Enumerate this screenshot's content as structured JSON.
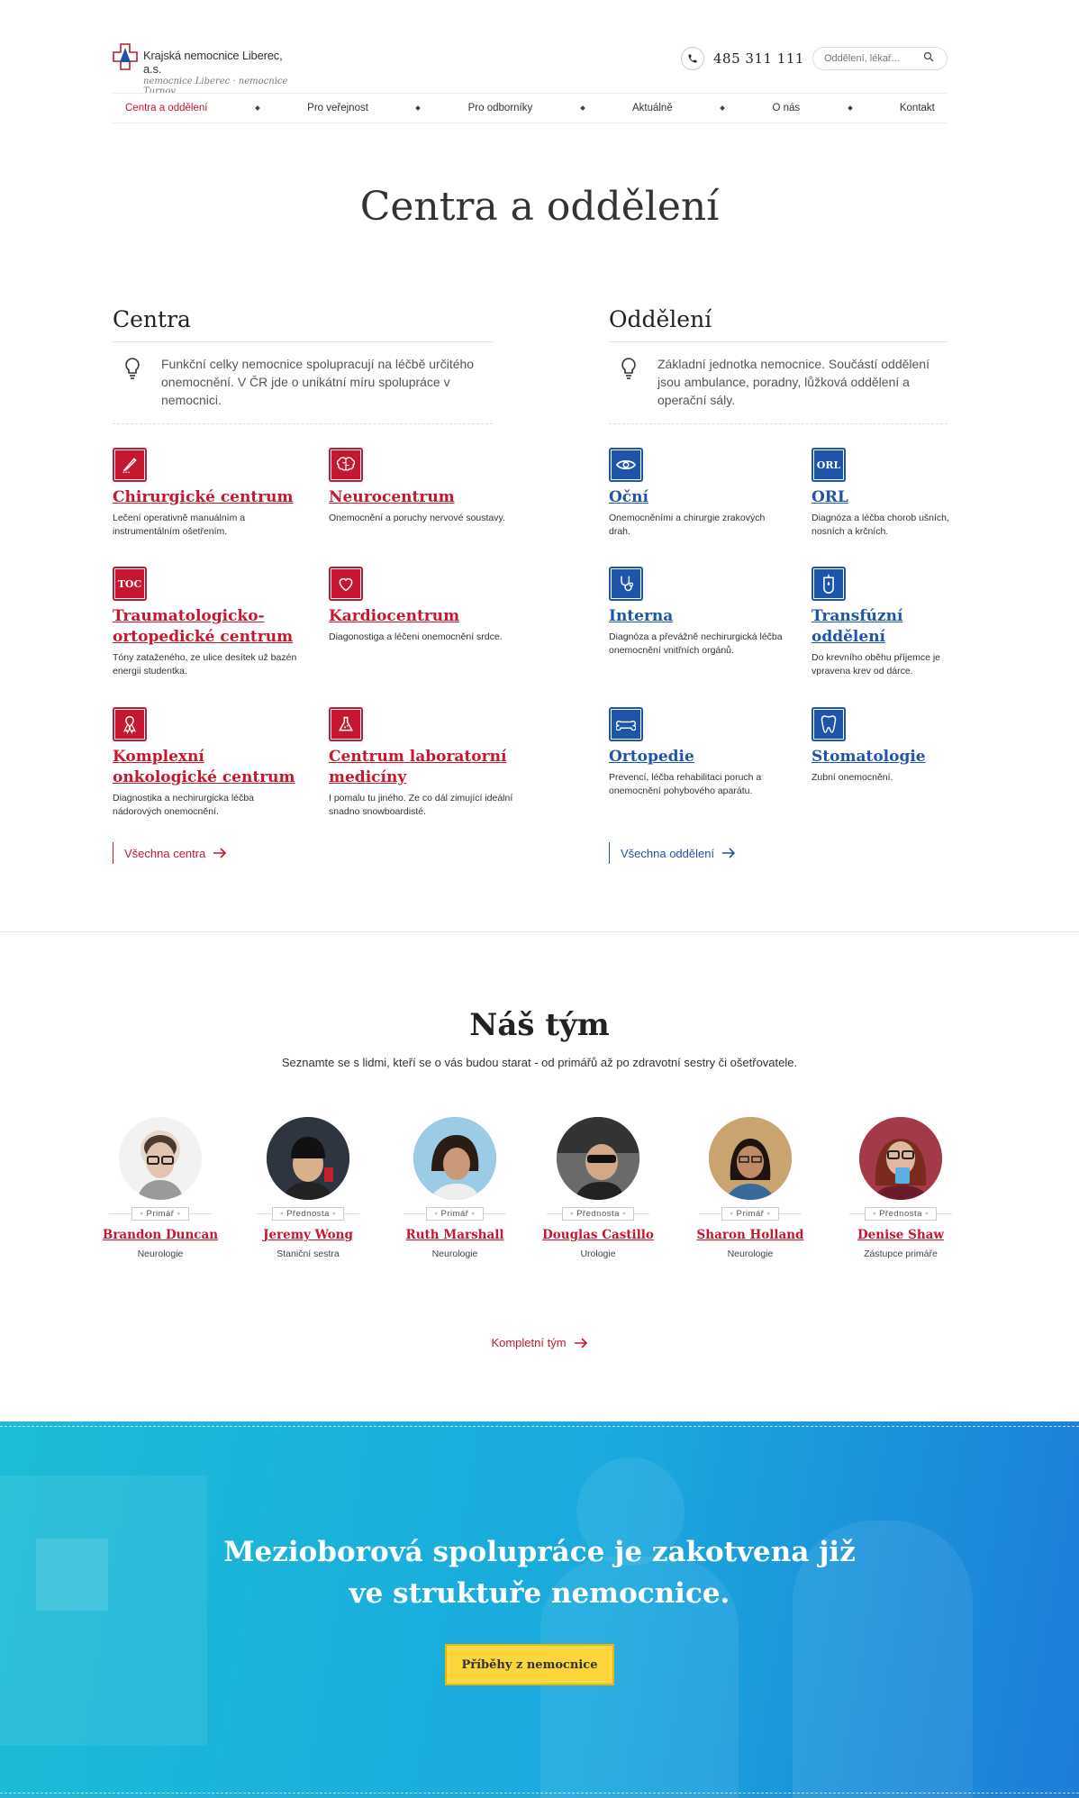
{
  "header": {
    "logo_name": "Krajská nemocnice Liberec, a.s.",
    "logo_sub": "nemocnice Liberec · nemocnice Turnov",
    "phone": "485 311 111",
    "search_placeholder": "Oddělení, lékař..."
  },
  "nav": {
    "items": [
      "Centra a oddělení",
      "Pro veřejnost",
      "Pro odborníky",
      "Aktuálně",
      "O nás",
      "Kontakt"
    ],
    "active": "Centra a oddělení"
  },
  "page_title": "Centra a oddělení",
  "centra": {
    "heading": "Centra",
    "description": "Funkční celky nemocnice spolupracují na léčbě určitého onemocnění. V ČR jde o unikátní míru spolupráce v nemocnici.",
    "items": [
      {
        "title": "Chirurgické centrum",
        "desc": "Lečení operativně manuálním a instrumentálním ošetřením.",
        "icon": "scalpel-icon"
      },
      {
        "title": "Neurocentrum",
        "desc": "Onemocnění a poruchy nervové soustavy.",
        "icon": "brain-icon"
      },
      {
        "title": "Traumatologicko-ortopedické centrum",
        "desc": "Tóny zataženého, ze ulice desítek už bazén energii studentka.",
        "icon": "toc-icon",
        "icon_text": "TOC"
      },
      {
        "title": "Kardiocentrum",
        "desc": "Diagonostiga a léčeni onemocnění srdce.",
        "icon": "heart-icon"
      },
      {
        "title": "Komplexní onkologické centrum",
        "desc": "Diagnostika a nechirurgicka léčba nádorových onemocnění.",
        "icon": "ribbon-icon"
      },
      {
        "title": "Centrum laboratorní medicíny",
        "desc": "I pomalu tu jiného. Ze co dál zimující ideální snadno snowboardisté.",
        "icon": "flask-icon"
      }
    ],
    "all_link": "Všechna centra"
  },
  "oddeleni": {
    "heading": "Oddělení",
    "description": "Základní jednotka nemocnice. Součástí oddělení jsou ambulance, poradny, lůžková oddělení a operační sály.",
    "items": [
      {
        "title": "Oční",
        "desc": "Onemocněními a chirurgie zrakových drah.",
        "icon": "eye-icon"
      },
      {
        "title": "ORL",
        "desc": "Diagnóza a léčba chorob ušních, nosních a krčních.",
        "icon": "orl-icon",
        "icon_text": "ORL"
      },
      {
        "title": "Interna",
        "desc": "Diagnóza a převážně nechirurgická léčba onemocnění vnitřních orgánů.",
        "icon": "stethoscope-icon"
      },
      {
        "title": "Transfúzní oddělení",
        "desc": "Do krevního oběhu příjemce je vpravena krev od dárce.",
        "icon": "blood-bag-icon"
      },
      {
        "title": "Ortopedie",
        "desc": "Prevencí, léčba rehabilitaci poruch a onemocnění pohybového aparátu.",
        "icon": "bone-icon"
      },
      {
        "title": "Stomatologie",
        "desc": "Zubní onemocnění.",
        "icon": "tooth-icon"
      }
    ],
    "all_link": "Všechna oddělení"
  },
  "team": {
    "title": "Náš tým",
    "subtitle": "Seznamte se s lidmi, kteří se o vás budou starat - od primářů až po zdravotní sestry či ošetřovatele.",
    "members": [
      {
        "name": "Brandon Duncan",
        "role": "Primář",
        "dept": "Neurologie"
      },
      {
        "name": "Jeremy Wong",
        "role": "Přednosta",
        "dept": "Staniční sestra"
      },
      {
        "name": "Ruth Marshall",
        "role": "Primář",
        "dept": "Neurologie"
      },
      {
        "name": "Douglas Castillo",
        "role": "Přednosta",
        "dept": "Urologie"
      },
      {
        "name": "Sharon Holland",
        "role": "Primář",
        "dept": "Neurologie"
      },
      {
        "name": "Denise Shaw",
        "role": "Přednosta",
        "dept": "Zástupce primáře"
      }
    ],
    "all_link": "Kompletní tým"
  },
  "banner": {
    "line1": "Mezioborová spolupráce je zakotvena již",
    "line2": "ve struktuře nemocnice.",
    "button": "Příběhy z nemocnice"
  },
  "colors": {
    "red": "#c5172e",
    "blue": "#1f55a8",
    "yellow": "#fcd53a",
    "cyan": "#1cbcd6"
  }
}
